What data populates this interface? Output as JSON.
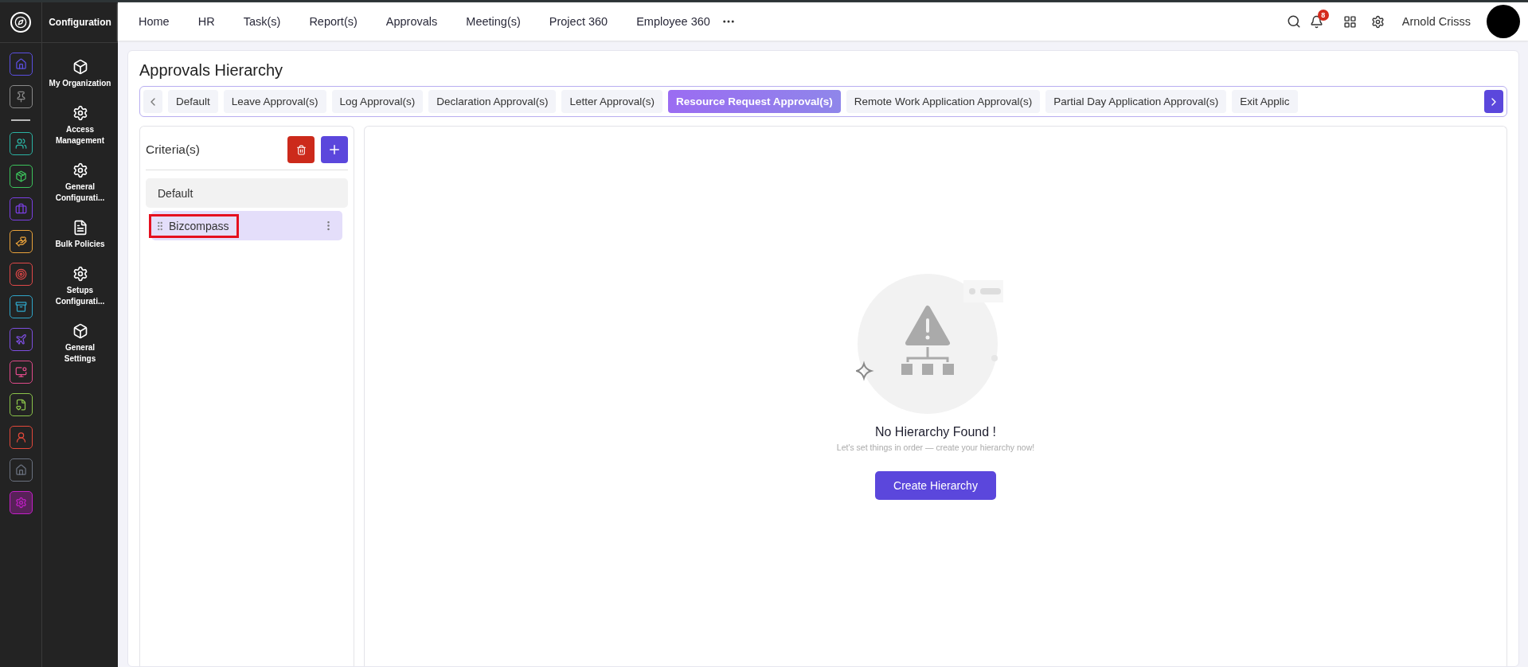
{
  "rail": [
    {
      "color": "#5b4fe0",
      "selected": false
    },
    {
      "color": "#8a8a8a",
      "selected": false
    },
    {
      "color": "#2bb3a3",
      "selected": false
    },
    {
      "color": "#3cc35c",
      "selected": false
    },
    {
      "color": "#7b3fe4",
      "selected": false
    },
    {
      "color": "#e9a23b",
      "selected": false
    },
    {
      "color": "#e04848",
      "selected": false
    },
    {
      "color": "#2fa6c9",
      "selected": false
    },
    {
      "color": "#7d4fe0",
      "selected": false
    },
    {
      "color": "#e04a8a",
      "selected": false
    },
    {
      "color": "#8bc34a",
      "selected": false
    },
    {
      "color": "#e2483a",
      "selected": false
    },
    {
      "color": "#6b7280",
      "selected": false
    },
    {
      "color": "#c21fc7",
      "selected": true
    }
  ],
  "sidebar": {
    "title": "Configuration",
    "items": [
      "My Organization",
      "Access Management",
      "General Configurati...",
      "Bulk Policies",
      "Setups Configurati...",
      "General Settings"
    ]
  },
  "top_nav": {
    "items": [
      "Home",
      "HR",
      "Task(s)",
      "Report(s)",
      "Approvals",
      "Meeting(s)",
      "Project 360",
      "Employee 360"
    ],
    "notification_count": "8",
    "user": "Arnold Crisss"
  },
  "page": {
    "title": "Approvals Hierarchy",
    "tabs": [
      {
        "label": "Default",
        "selected": false
      },
      {
        "label": "Leave Approval(s)",
        "selected": false
      },
      {
        "label": "Log Approval(s)",
        "selected": false
      },
      {
        "label": "Declaration Approval(s)",
        "selected": false
      },
      {
        "label": "Letter Approval(s)",
        "selected": false
      },
      {
        "label": "Resource Request Approval(s)",
        "selected": true
      },
      {
        "label": "Remote Work Application Approval(s)",
        "selected": false
      },
      {
        "label": "Partial Day Application Approval(s)",
        "selected": false
      },
      {
        "label": "Exit Applic",
        "selected": false
      }
    ],
    "criteria": {
      "title": "Criteria(s)",
      "items": [
        {
          "kind": "default",
          "label": "Default",
          "selected": false
        },
        {
          "kind": "custom",
          "label": "Bizcompass",
          "selected": true,
          "highlighted": true
        }
      ]
    },
    "empty_state": {
      "title": "No Hierarchy Found !",
      "subtitle": "Let's set things in order — create your hierarchy now!",
      "button": "Create Hierarchy"
    }
  }
}
